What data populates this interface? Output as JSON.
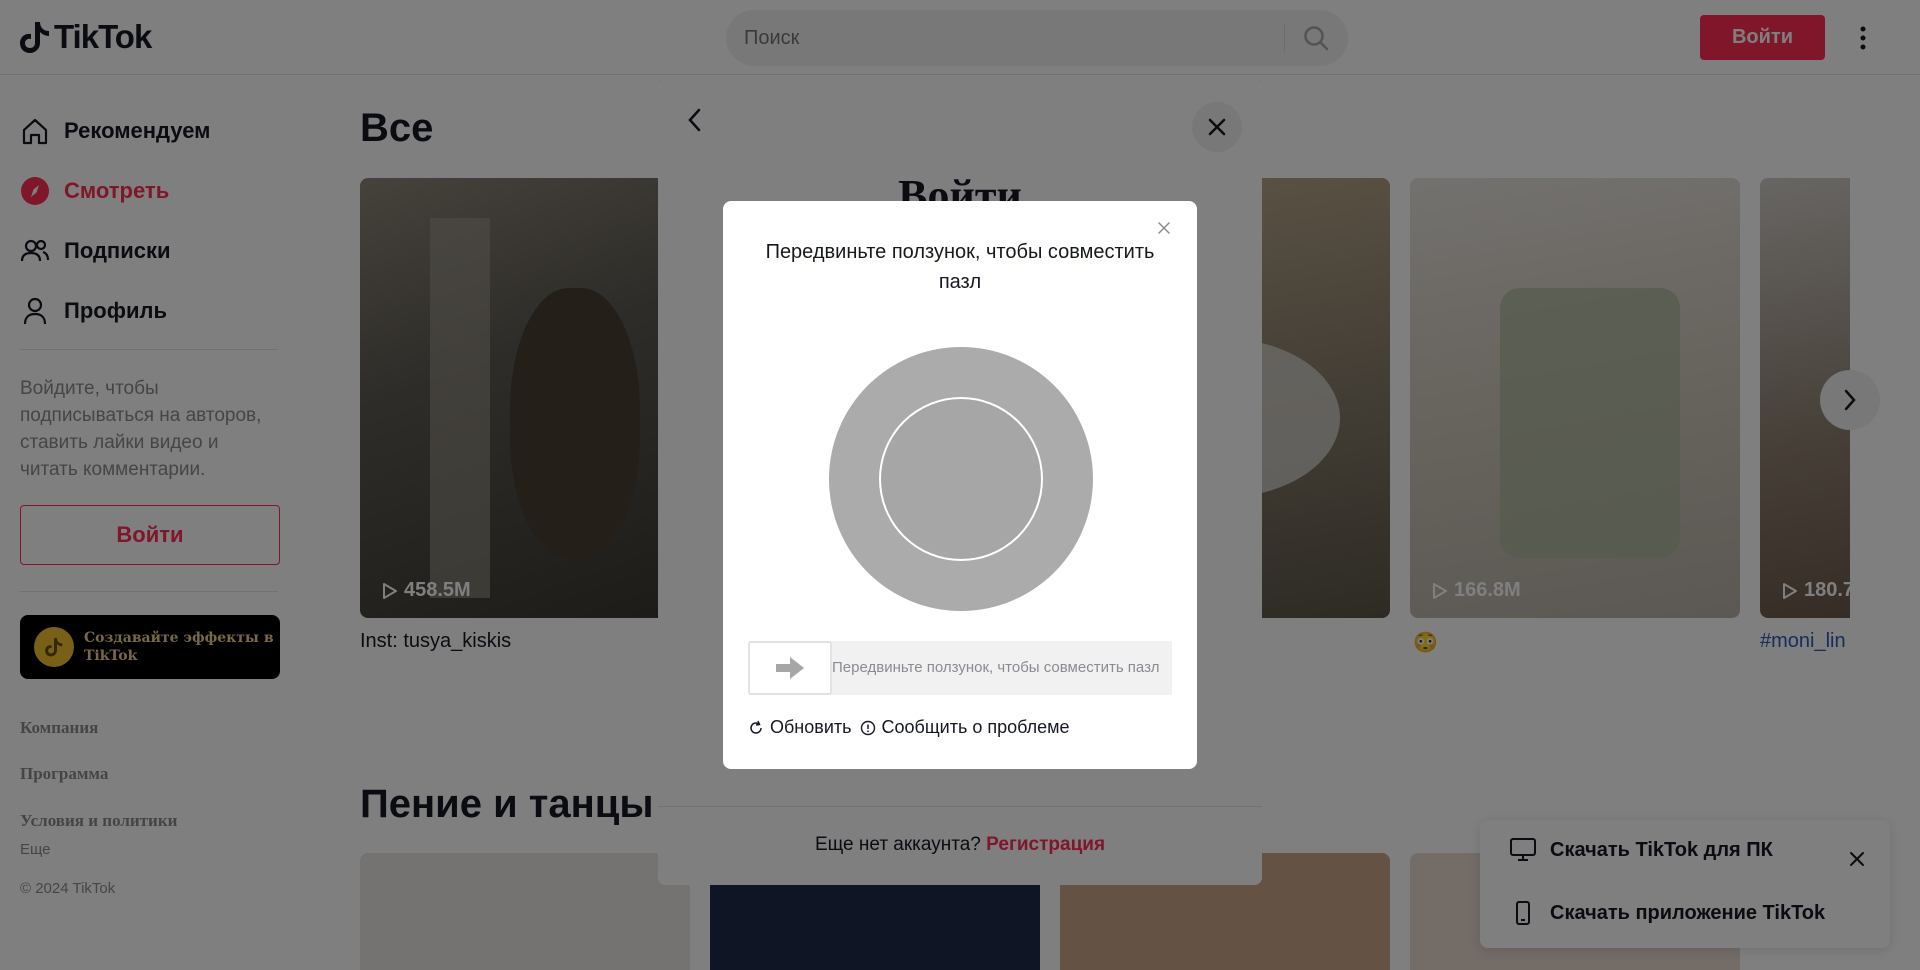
{
  "header": {
    "logo_text": "TikTok",
    "search_placeholder": "Поиск",
    "login_label": "Войти"
  },
  "sidebar": {
    "nav": [
      {
        "label": "Рекомендуем",
        "icon": "home-icon"
      },
      {
        "label": "Смотреть",
        "icon": "compass-icon",
        "active": true
      },
      {
        "label": "Подписки",
        "icon": "users-icon"
      },
      {
        "label": "Профиль",
        "icon": "user-icon"
      }
    ],
    "description": "Войдите, чтобы подписываться на авторов, ставить лайки видео и читать комментарии.",
    "login_label": "Войти",
    "effects_banner": "Создавайте эффекты в TikTok",
    "footer_links": [
      "Компания",
      "Программа",
      "Условия и политики"
    ],
    "more_label": "Еще",
    "copyright": "© 2024 TikTok"
  },
  "main": {
    "section1_title": "Все",
    "section2_title": "Пение и танцы",
    "cards": [
      {
        "views": "458.5M",
        "caption": "Inst: tusya_kiskis"
      },
      {
        "views": "",
        "caption": ""
      },
      {
        "views": "",
        "caption": "😊"
      },
      {
        "views": "166.8M",
        "caption": "😳"
      },
      {
        "views": "180.7",
        "caption": "#moni_lin"
      }
    ]
  },
  "download_panel": {
    "pc_label": "Скачать TikTok для ПК",
    "app_label": "Скачать приложение TikTok"
  },
  "login_modal": {
    "title": "Войти",
    "footer_text": "Еще нет аккаунта?",
    "register_label": "Регистрация"
  },
  "captcha": {
    "title": "Передвиньте ползунок, чтобы совместить пазл",
    "slider_hint": "Передвиньте ползунок, чтобы совместить пазл",
    "refresh_label": "Обновить",
    "report_label": "Сообщить о проблеме"
  },
  "colors": {
    "accent": "#fe2c55",
    "overlay": "rgba(0,0,0,0.5)"
  }
}
